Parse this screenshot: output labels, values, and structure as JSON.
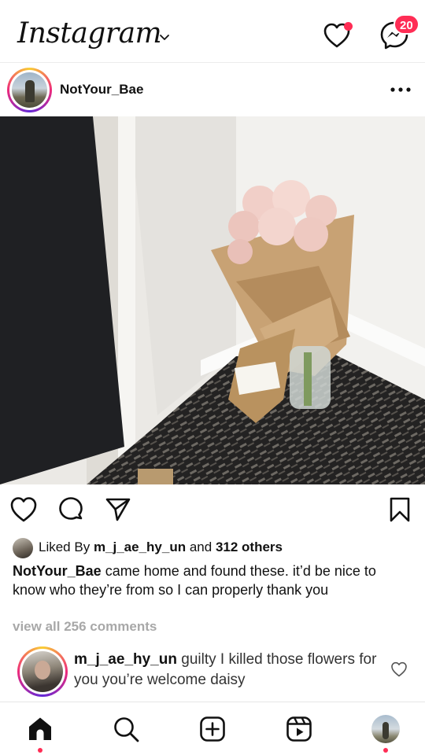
{
  "header": {
    "logo": "Instagram",
    "messages_badge": "20"
  },
  "post": {
    "username": "NotYour_Bae",
    "image_alt": "Pink roses wrapped in brown paper left in a hallway corner",
    "liked_by_prefix": "Liked By ",
    "liked_by_user": "m_j_ae_hy_un",
    "liked_by_and": " and ",
    "liked_by_others": "312 others",
    "caption_user": "NotYour_Bae",
    "caption_text": " came home and found these. it’d be nice to know who they’re from so I can properly thank you",
    "view_all_comments": "view all 256 comments"
  },
  "comment": {
    "user": "m_j_ae_hy_un",
    "text": " guilty I killed those flowers for you you’re welcome daisy"
  },
  "nav": {
    "items": [
      "home",
      "search",
      "create",
      "reels",
      "profile"
    ]
  },
  "colors": {
    "accent": "#ff2d55",
    "muted": "#a8a8a8",
    "text": "#111111"
  },
  "icons": {
    "header": [
      "chevron-down-icon",
      "heart-icon",
      "messenger-icon"
    ],
    "actions": [
      "heart-icon",
      "comment-icon",
      "share-icon",
      "bookmark-icon"
    ],
    "nav": [
      "home-icon",
      "search-icon",
      "plus-square-icon",
      "reels-icon"
    ]
  }
}
